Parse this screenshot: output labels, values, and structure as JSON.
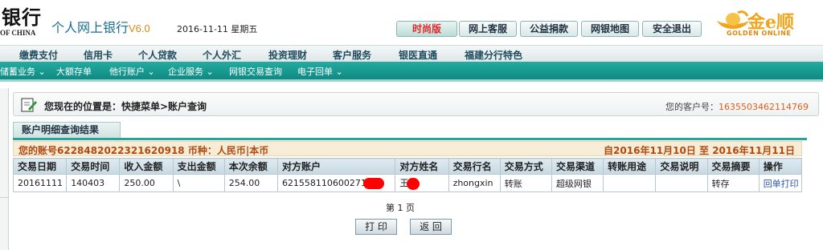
{
  "header": {
    "bank_cn": "银行",
    "bank_en": "OF CHINA",
    "product_name": "个人网上银行",
    "version": "V6.0",
    "date": "2016-11-11 星期五",
    "buttons": [
      "时尚版",
      "网上客服",
      "公益捐款",
      "网银地图",
      "安全退出"
    ],
    "partner_cn": "金e顺",
    "partner_en": "GOLDEN ONLINE"
  },
  "main_nav": [
    "缴费支付",
    "信用卡",
    "个人贷款",
    "个人外汇",
    "投资理财",
    "客户服务",
    "银医直通",
    "福建分行特色"
  ],
  "sub_nav": [
    "储蓄业务 ⌄",
    "大额存单",
    "他行账户 ⌄",
    "企业服务 ⌄",
    "网银交易查询",
    "电子回单 ⌄"
  ],
  "location": {
    "text": "您现在的位置是：快捷菜单>账户查询",
    "customer_label": "您的客户号：",
    "customer_no": "1635503462114769"
  },
  "tab": {
    "label": "账户明细查询结果"
  },
  "account_bar": {
    "left": "您的账号6228482022321620918 币种：人民币|本币",
    "right": "自2016年11月10日  至  2016年11月11日"
  },
  "table": {
    "columns": [
      "交易日期",
      "交易时间",
      "收入金额",
      "支出金额",
      "本次余额",
      "对方账户",
      "对方姓名",
      "交易行名",
      "交易方式",
      "交易渠道",
      "转账用途",
      "交易说明",
      "交易摘要",
      "操作"
    ],
    "rows": [
      {
        "date": "20161111",
        "time": "140403",
        "income": "250.00",
        "expense": "\\",
        "balance": "254.00",
        "counter_account": "621558110600271",
        "counter_name": "王",
        "bank_name": "zhongxin",
        "method": "转账",
        "channel": "超级网银",
        "purpose": "",
        "description": "",
        "summary": "转存",
        "action": "回单打印"
      }
    ]
  },
  "pager": "第 1 页",
  "buttons": {
    "print": "打 印",
    "back": "返 回"
  },
  "colors": {
    "teal": "#1a9e95",
    "accent_orange": "#ea5a1a",
    "account_brown": "#b04a10",
    "redaction": "#ff0000"
  }
}
